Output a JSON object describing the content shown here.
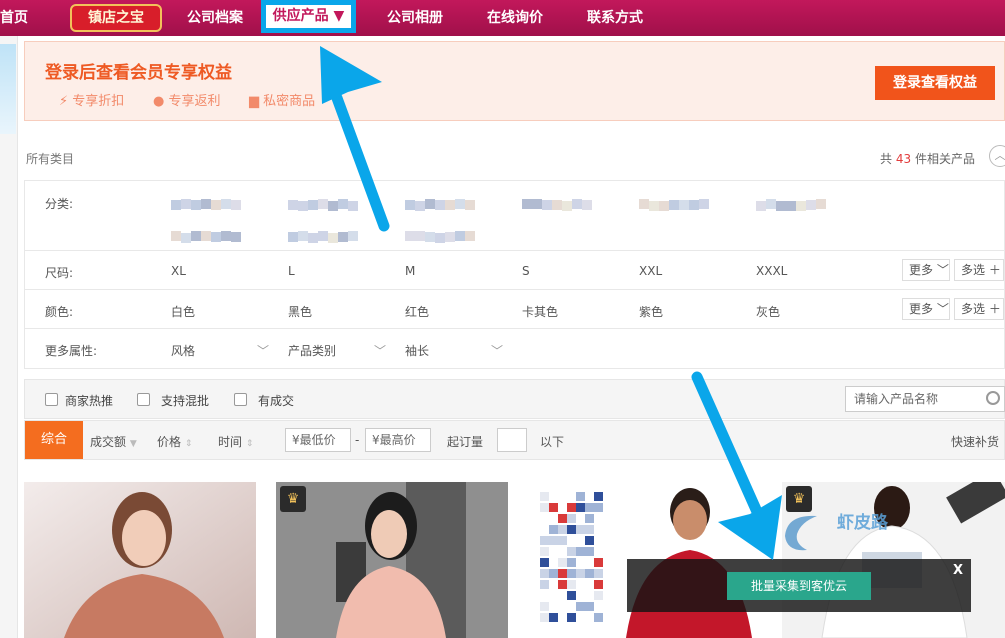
{
  "nav": {
    "items": [
      "首页",
      "镇店之宝",
      "公司档案",
      "供应产品 ▼",
      "公司相册",
      "在线询价",
      "联系方式"
    ]
  },
  "banner": {
    "title": "登录后查看会员专享权益",
    "perks": [
      "专享折扣",
      "专享返利",
      "私密商品"
    ],
    "login_button": "登录查看权益"
  },
  "breadcrumb": {
    "root": "所有类目",
    "count_prefix": "共",
    "count": "43",
    "count_suffix": "件相关产品"
  },
  "filters": {
    "category_label": "分类:",
    "size_label": "尺码:",
    "sizes": [
      "XL",
      "L",
      "M",
      "S",
      "XXL",
      "XXXL"
    ],
    "color_label": "颜色:",
    "colors": [
      "白色",
      "黑色",
      "红色",
      "卡其色",
      "紫色",
      "灰色"
    ],
    "more_label": "更多",
    "multi_label": "多选",
    "attr_label": "更多属性:",
    "attrs": [
      "风格",
      "产品类别",
      "袖长"
    ]
  },
  "options": {
    "checkboxes": [
      "商家热推",
      "支持混批",
      "有成交"
    ],
    "search_placeholder": "请输入产品名称"
  },
  "sort": {
    "default": "综合",
    "items": [
      "成交额",
      "价格",
      "时间"
    ],
    "min_price": "¥最低价",
    "dash": "-",
    "max_price": "¥最高价",
    "moq_label": "起订量",
    "moq_suffix": "以下",
    "quick_restock": "快速补货"
  },
  "overlay": {
    "collect_button": "批量采集到客优云",
    "close": "X"
  },
  "watermark": {
    "text": "虾皮路"
  },
  "colors": {
    "nav_bg": "#b0124f",
    "accent_orange": "#f46d1f",
    "annotation_blue": "#0aa6ea"
  }
}
